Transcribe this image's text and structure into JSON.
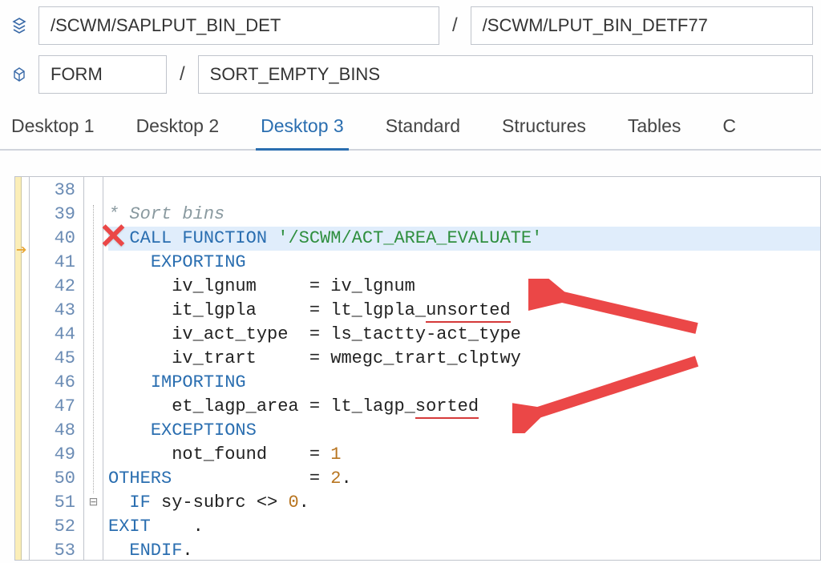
{
  "breadcrumb": {
    "program": "/SCWM/SAPLPUT_BIN_DET",
    "include": "/SCWM/LPUT_BIN_DETF77",
    "objtype": "FORM",
    "objname": "SORT_EMPTY_BINS"
  },
  "tabs": [
    "Desktop 1",
    "Desktop 2",
    "Desktop 3",
    "Standard",
    "Structures",
    "Tables",
    "C"
  ],
  "active_tab": 2,
  "code": {
    "first_line": 38,
    "lines": [
      {
        "n": 38,
        "t": "",
        "cls": ""
      },
      {
        "n": 39,
        "t": "* Sort bins",
        "cls": "comment"
      },
      {
        "n": 40,
        "prefix": "  ",
        "k1": "CALL FUNCTION",
        "sp": " ",
        "s": "'/SCWM/ACT_AREA_EVALUATE'",
        "hl": true
      },
      {
        "n": 41,
        "prefix": "    ",
        "k1": "EXPORTING"
      },
      {
        "n": 42,
        "raw": "      iv_lgnum     = iv_lgnum"
      },
      {
        "n": 43,
        "raw": "      it_lgpla     = lt_lgpla_",
        "u": "unsorted"
      },
      {
        "n": 44,
        "raw": "      iv_act_type  = ls_tactty-act_type"
      },
      {
        "n": 45,
        "raw": "      iv_trart     = wmegc_trart_clptwy"
      },
      {
        "n": 46,
        "prefix": "    ",
        "k1": "IMPORTING"
      },
      {
        "n": 47,
        "raw": "      et_lagp_area = lt_lagp_",
        "u": "sorted"
      },
      {
        "n": 48,
        "prefix": "    ",
        "k1": "EXCEPTIONS"
      },
      {
        "n": 49,
        "raw": "      not_found    = ",
        "num": "1"
      },
      {
        "n": 50,
        "raw": "      ",
        "k1": "OTHERS",
        "raw2": "       = ",
        "num": "2",
        "dot": "."
      },
      {
        "n": 51,
        "fold": "⊟",
        "prefix": "  ",
        "k1": "IF",
        "raw": " sy-subrc <> ",
        "num": "0",
        "dot": "."
      },
      {
        "n": 52,
        "raw": "    ",
        "k1": "EXIT",
        "dot": "."
      },
      {
        "n": 53,
        "prefix": "  ",
        "k1": "ENDIF",
        "dot": "."
      }
    ]
  }
}
